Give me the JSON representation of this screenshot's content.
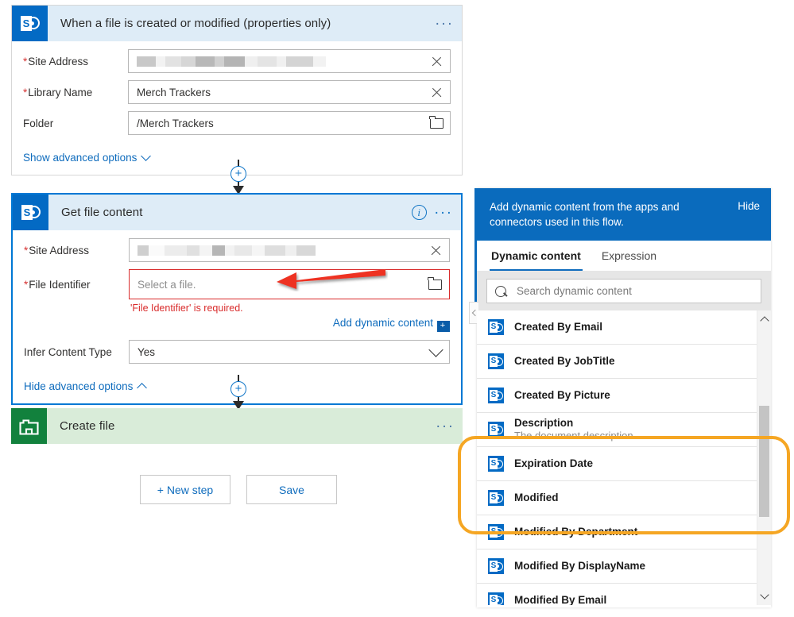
{
  "flow": {
    "trigger_card": {
      "title": "When a file is created or modified (properties only)",
      "icon": "sharepoint-icon",
      "menu": "...",
      "fields": [
        {
          "label": "Site Address",
          "required": true,
          "value": "",
          "redacted": true,
          "action_icon": "clear-x-icon"
        },
        {
          "label": "Library Name",
          "required": true,
          "value": "Merch Trackers",
          "redacted": false,
          "action_icon": "clear-x-icon"
        },
        {
          "label": "Folder",
          "required": false,
          "value": "/Merch Trackers",
          "redacted": false,
          "action_icon": "folder-icon"
        }
      ],
      "advanced_link": "Show advanced options"
    },
    "action_card": {
      "title": "Get file content",
      "icon": "sharepoint-icon",
      "info_icon": "info-icon",
      "menu": "...",
      "site_address": {
        "label": "Site Address",
        "required": true,
        "value": "",
        "redacted": true,
        "action_icon": "clear-x-icon"
      },
      "file_identifier": {
        "label": "File Identifier",
        "required": true,
        "placeholder": "Select a file.",
        "value": "",
        "action_icon": "folder-icon",
        "error": "'File Identifier' is required."
      },
      "add_dynamic_content": "Add dynamic content",
      "infer_content_type": {
        "label": "Infer Content Type",
        "required": false,
        "value": "Yes"
      },
      "advanced_link": "Hide advanced options"
    },
    "create_card": {
      "title": "Create file",
      "icon": "create-file-icon",
      "menu": "..."
    },
    "buttons": {
      "new_step": "+ New step",
      "save": "Save"
    },
    "connector_plus": "+"
  },
  "dynamic_panel": {
    "banner_text": "Add dynamic content from the apps and connectors used in this flow.",
    "hide_label": "Hide",
    "tabs": [
      {
        "label": "Dynamic content",
        "active": true
      },
      {
        "label": "Expression",
        "active": false
      }
    ],
    "search": {
      "placeholder": "Search dynamic content",
      "value": ""
    },
    "items": [
      {
        "name": "Created By Email",
        "desc": "",
        "icon": "sharepoint-icon"
      },
      {
        "name": "Created By JobTitle",
        "desc": "",
        "icon": "sharepoint-icon"
      },
      {
        "name": "Created By Picture",
        "desc": "",
        "icon": "sharepoint-icon"
      },
      {
        "name": "Description",
        "desc": "The document description",
        "icon": "sharepoint-icon"
      },
      {
        "name": "Expiration Date",
        "desc": "",
        "icon": "sharepoint-icon"
      },
      {
        "name": "Modified",
        "desc": "",
        "icon": "sharepoint-icon"
      },
      {
        "name": "Modified By Department",
        "desc": "",
        "icon": "sharepoint-icon"
      },
      {
        "name": "Modified By DisplayName",
        "desc": "",
        "icon": "sharepoint-icon"
      },
      {
        "name": "Modified By Email",
        "desc": "",
        "icon": "sharepoint-icon"
      }
    ]
  },
  "annotations": {
    "arrow_color": "#ee3124",
    "highlight_color": "#f5a623"
  },
  "colors": {
    "sharepoint_blue": "#036ac4",
    "card_header_blue": "#deecf7",
    "card_header_green": "#d9ecd9",
    "create_icon_green": "#12813d",
    "link_blue": "#0f6cbd",
    "banner_blue": "#0a6bbd",
    "error_red": "#d92b2b"
  }
}
